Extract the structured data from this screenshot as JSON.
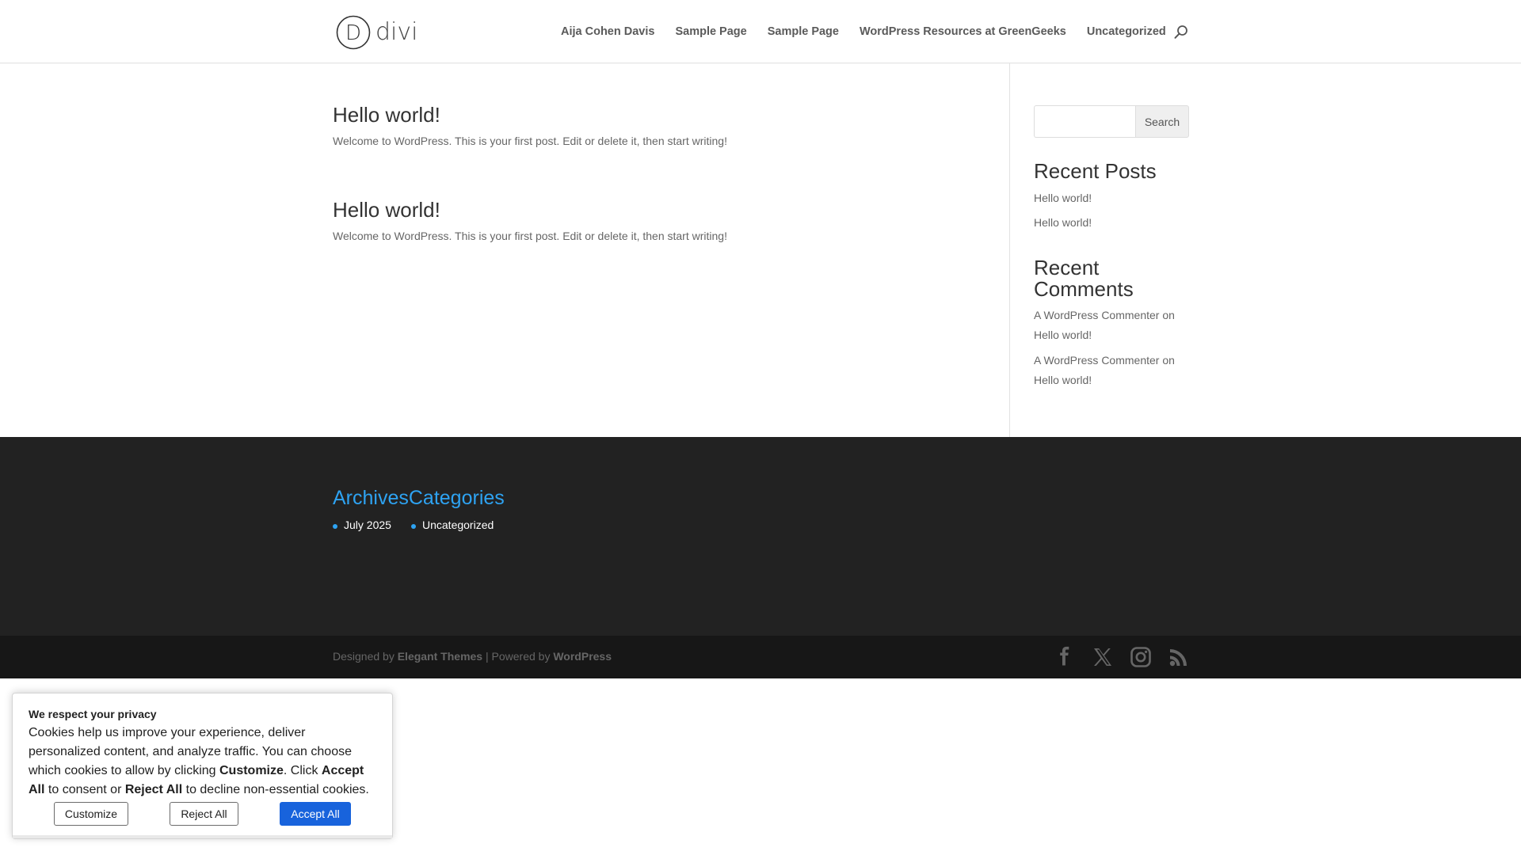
{
  "header": {
    "logo_text": "divi",
    "logo_letter": "D",
    "nav": [
      "Aija Cohen Davis",
      "Sample Page",
      "Sample Page",
      "WordPress Resources at GreenGeeks",
      "Uncategorized"
    ]
  },
  "posts": [
    {
      "title": "Hello world!",
      "excerpt": "Welcome to WordPress. This is your first post. Edit or delete it, then start writing!"
    },
    {
      "title": "Hello world!",
      "excerpt": "Welcome to WordPress. This is your first post. Edit or delete it, then start writing!"
    }
  ],
  "sidebar": {
    "search_value": "",
    "search_button": "Search",
    "recent_posts_title": "Recent Posts",
    "recent_posts": [
      "Hello world!",
      "Hello world!"
    ],
    "recent_comments_title": "Recent Comments",
    "recent_comments": [
      {
        "author": "A WordPress Commenter",
        "on": "on",
        "post": "Hello world!"
      },
      {
        "author": "A WordPress Commenter",
        "on": "on",
        "post": "Hello world!"
      }
    ]
  },
  "footer": {
    "archives_title": "Archives",
    "categories_title": "Categories",
    "archives": [
      "July 2025"
    ],
    "categories": [
      "Uncategorized"
    ],
    "accent_color": "#2ea3f2"
  },
  "bottom_bar": {
    "designed_by": "Designed by",
    "theme_author": "Elegant Themes",
    "separator": "| Powered by",
    "platform": "WordPress",
    "socials": [
      "facebook-icon",
      "x-icon",
      "instagram-icon",
      "rss-icon"
    ]
  },
  "cookie": {
    "title": "We respect your privacy",
    "text_1": "Cookies help us improve your experience, deliver personalized content, and analyze traffic. You can choose which cookies to allow by clicking ",
    "text_customize": "Customize",
    "text_2": ". Click ",
    "text_accept": "Accept All",
    "text_3": " to consent or ",
    "text_reject": "Reject All",
    "text_4": " to decline non-essential cookies.",
    "customize_button": "Customize",
    "reject_button": "Reject All",
    "accept_button": "Accept All",
    "accept_color": "#1863dc"
  }
}
